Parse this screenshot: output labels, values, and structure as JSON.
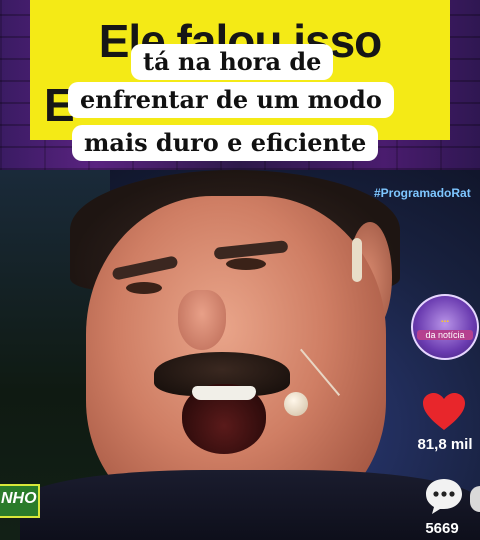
{
  "banner": {
    "text": "Ele falou isso",
    "partial_char": "E",
    "color": "#f4ea16"
  },
  "captions": [
    "tá na hora de",
    "enfrentar de um modo",
    "mais duro e eficiente"
  ],
  "video": {
    "hashtag": "#ProgramadoRat",
    "logo_top": "...",
    "logo_sub": "da notícia",
    "show_tag": "NHO"
  },
  "actions": {
    "likes": "81,8 mil",
    "comments": "5669",
    "like_color": "#e8262b"
  }
}
